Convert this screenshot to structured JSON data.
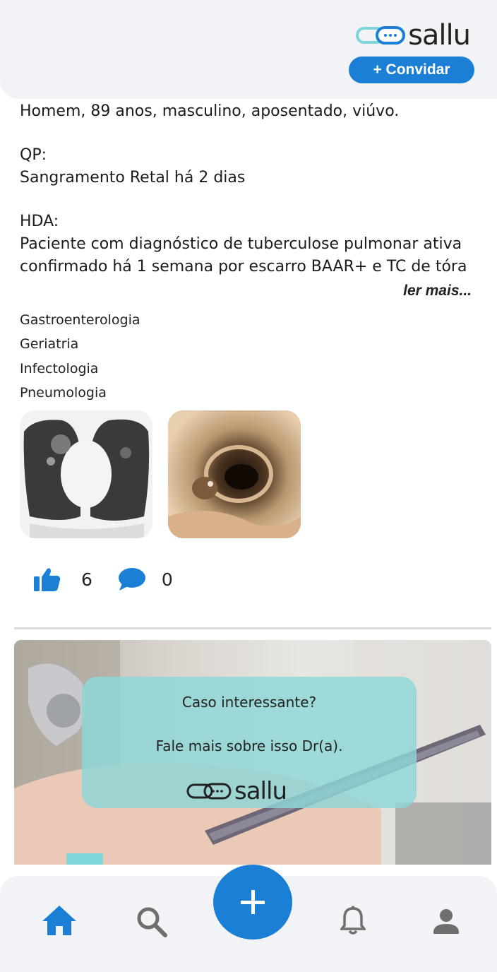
{
  "header": {
    "brand": "sallu",
    "invite_label": "+ Convidar"
  },
  "post": {
    "lines": [
      "Homem, 89 anos, masculino, aposentado, viúvo.",
      "QP:",
      "Sangramento Retal há 2 dias",
      "HDA:",
      "Paciente com diagnóstico de tuberculose pulmonar ativa",
      "confirmado há 1 semana por escarro BAAR+ e TC de tóra"
    ],
    "read_more": "ler mais...",
    "tags": [
      "Gastroenterologia",
      "Geriatria",
      "Infectologia",
      "Pneumologia"
    ],
    "images": [
      "chest-ct-image",
      "endoscopy-image"
    ],
    "likes": "6",
    "comments": "0"
  },
  "banner": {
    "title": "Caso interessante?",
    "subtitle": "Fale mais sobre isso Dr(a).",
    "brand": "sallu"
  },
  "nav": {
    "items": [
      "home-icon",
      "search-icon",
      "add-icon",
      "bell-icon",
      "profile-icon"
    ],
    "active": "home",
    "accent": "#1c7fd6"
  }
}
